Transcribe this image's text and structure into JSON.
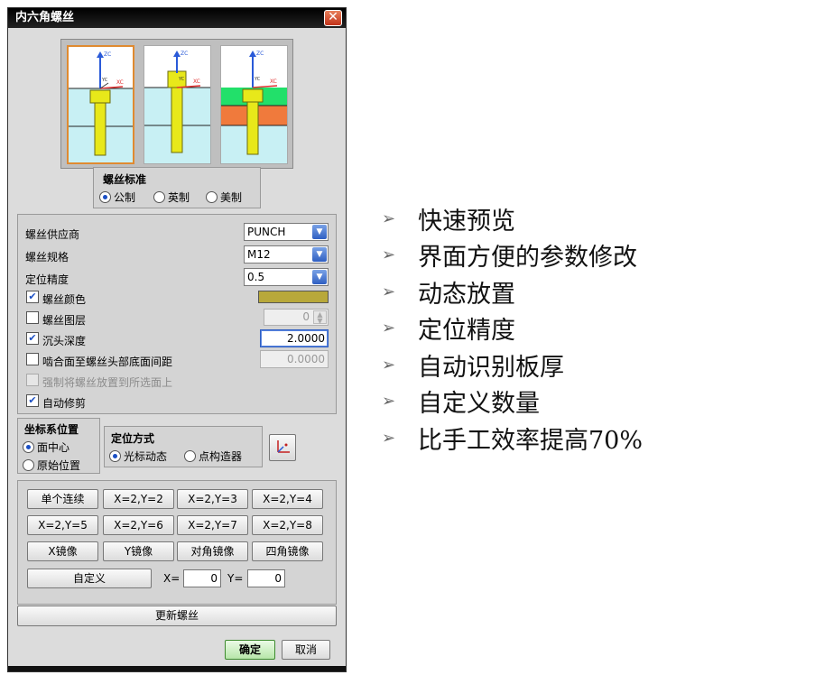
{
  "dialog": {
    "title": "内六角螺丝",
    "close_symbol": "✕"
  },
  "preview": {
    "axis_zc": "ZC",
    "axis_xc": "XC",
    "axis_yc": "YC",
    "selected_index": 0
  },
  "screw_standard": {
    "title": "螺丝标准",
    "options": [
      "公制",
      "英制",
      "美制"
    ],
    "selected": "公制"
  },
  "params": {
    "supplier_label": "螺丝供应商",
    "supplier_value": "PUNCH",
    "spec_label": "螺丝规格",
    "spec_value": "M12",
    "precision_label": "定位精度",
    "precision_value": "0.5",
    "color_label": "螺丝颜色",
    "color_checked": true,
    "color_value": "#b8a83a",
    "layer_label": "螺丝图层",
    "layer_checked": false,
    "layer_value": "0",
    "counterbore_label": "沉头深度",
    "counterbore_checked": true,
    "counterbore_value": "2.0000",
    "gap_label": "啮合面至螺丝头部底面间距",
    "gap_checked": false,
    "gap_value": "0.0000",
    "force_label": "强制将螺丝放置到所选面上",
    "force_checked": false,
    "trim_label": "自动修剪",
    "trim_checked": true
  },
  "csys": {
    "title": "坐标系位置",
    "options": [
      "面中心",
      "原始位置"
    ],
    "selected": "面中心"
  },
  "positioning": {
    "title": "定位方式",
    "options": [
      "光标动态",
      "点构造器"
    ],
    "selected": "光标动态"
  },
  "patterns": {
    "rows": [
      [
        "单个连续",
        "X=2,Y=2",
        "X=2,Y=3",
        "X=2,Y=4"
      ],
      [
        "X=2,Y=5",
        "X=2,Y=6",
        "X=2,Y=7",
        "X=2,Y=8"
      ],
      [
        "X镜像",
        "Y镜像",
        "对角镜像",
        "四角镜像"
      ]
    ],
    "custom_label": "自定义",
    "x_label": "X=",
    "x_value": "0",
    "y_label": "Y=",
    "y_value": "0"
  },
  "update_label": "更新螺丝",
  "ok_label": "确定",
  "cancel_label": "取消",
  "features": {
    "bullet": "➢",
    "items": [
      "快速预览",
      "界面方便的参数修改",
      "动态放置",
      "定位精度",
      "自动识别板厚",
      "自定义数量",
      "比手工效率提高70%"
    ]
  },
  "colors": {
    "plate_cyan": "#c8f0f4",
    "plate_green": "#22e06a",
    "plate_orange": "#f07a3c",
    "screw_yellow": "#e8e81a",
    "axis_blue": "#2a5ad8",
    "axis_red": "#e03030"
  }
}
